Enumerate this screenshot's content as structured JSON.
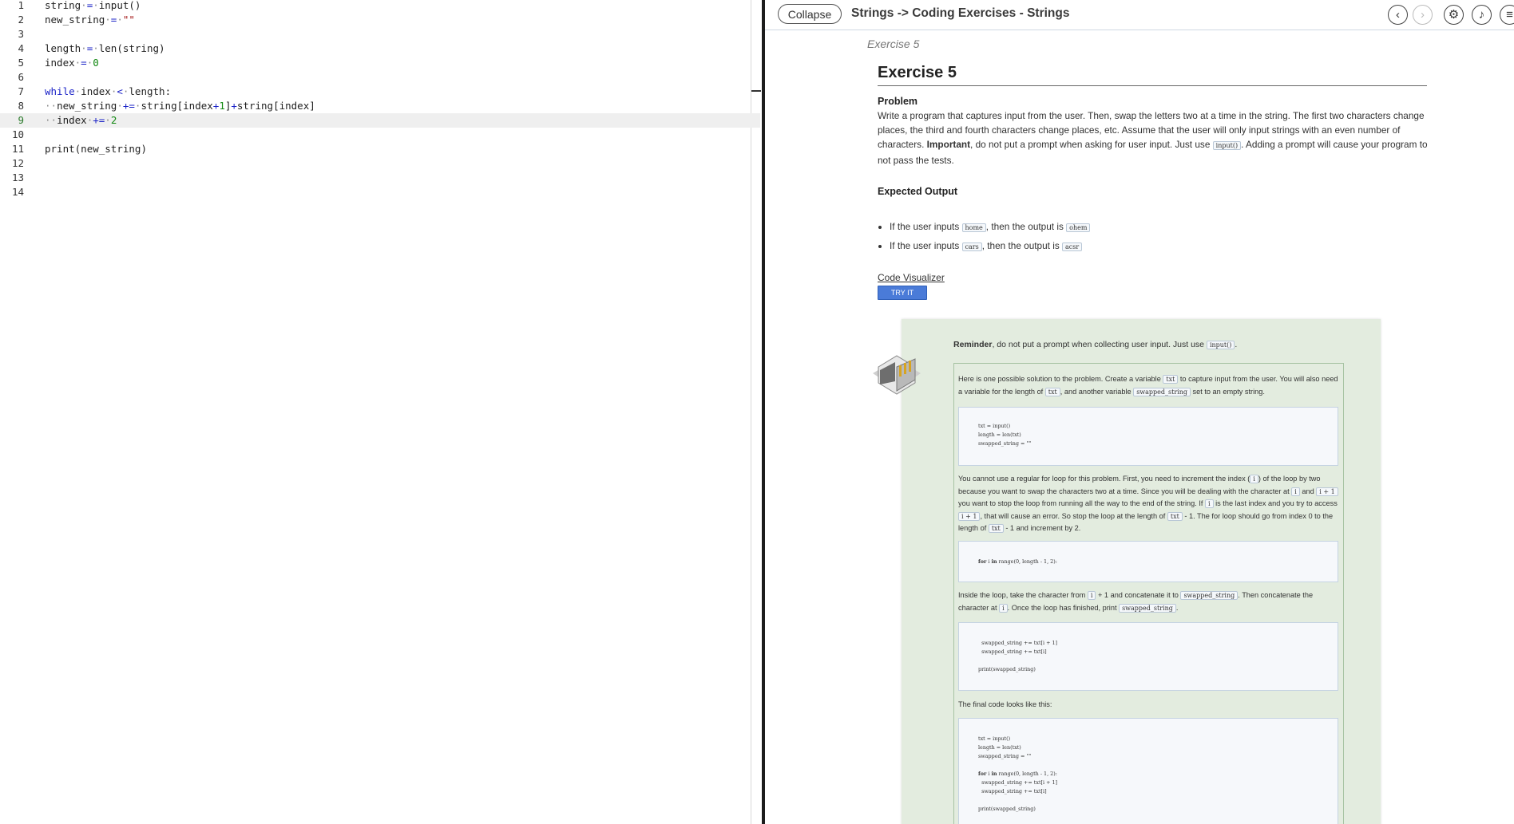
{
  "editor": {
    "lines": [
      {
        "n": "1",
        "t": "string·=·input()"
      },
      {
        "n": "2",
        "t": "new_string·=·\"\""
      },
      {
        "n": "3",
        "t": ""
      },
      {
        "n": "4",
        "t": "length·=·len(string)"
      },
      {
        "n": "5",
        "t": "index·=·0"
      },
      {
        "n": "6",
        "t": ""
      },
      {
        "n": "7",
        "t": "while·index·<·length:"
      },
      {
        "n": "8",
        "t": "··new_string·+=·string[index+1]+string[index]"
      },
      {
        "n": "9",
        "t": "··index·+=·2"
      },
      {
        "n": "10",
        "t": ""
      },
      {
        "n": "11",
        "t": "print(new_string)"
      },
      {
        "n": "12",
        "t": ""
      },
      {
        "n": "13",
        "t": ""
      },
      {
        "n": "14",
        "t": ""
      }
    ],
    "active_line": "9"
  },
  "guide": {
    "collapse_label": "Collapse",
    "breadcrumb": "Strings -> Coding Exercises - Strings",
    "icons": [
      "chevron-left-icon",
      "chevron-right-icon",
      "gear-icon",
      "read-aloud-icon",
      "menu-icon"
    ],
    "subtitle": "Exercise 5",
    "title": "Exercise 5",
    "problem_heading": "Problem",
    "problem_text_1": "Write a program that captures input from the user. Then, swap the letters two at a time in the string. The first two characters change places, the third and fourth characters change places, etc. Assume that the user will only input strings with an even number of characters. ",
    "problem_important": "Important",
    "problem_text_2": ", do not put a prompt when asking for user input. Just use ",
    "problem_code": "input()",
    "problem_text_3": ". Adding a prompt will cause your program to not pass the tests.",
    "expected_heading": "Expected Output",
    "examples": [
      {
        "pre": "If the user inputs ",
        "input": "home",
        "mid": ", then the output is ",
        "output": "ohem"
      },
      {
        "pre": "If the user inputs ",
        "input": "cars",
        "mid": ", then the output is ",
        "output": "acsr"
      }
    ],
    "visualizer_label": "Code Visualizer",
    "try_label": "TRY IT",
    "reminder_bold": "Reminder",
    "reminder_text": ", do not put a prompt when collecting user input. Just use ",
    "reminder_code": "input()",
    "reminder_end": ".",
    "sol_p1_a": "Here is one possible solution to the problem. Create a variable ",
    "sol_p1_c1": "txt",
    "sol_p1_b": " to capture input from the user. You will also need a variable for the length of ",
    "sol_p1_c2": "txt",
    "sol_p1_c": ", and another variable ",
    "sol_p1_c3": "swapped_string",
    "sol_p1_d": " set to an empty string.",
    "code1": [
      "txt = input()",
      "length = len(txt)",
      "swapped_string = \"\""
    ],
    "sol_p2_a": "You cannot use a regular for loop for this problem. First, you need to increment the index (",
    "sol_p2_c1": "i",
    "sol_p2_b": ") of the loop by two because you want to swap the characters two at a time. Since you will be dealing with the character at ",
    "sol_p2_c2": "i",
    "sol_p2_c": " and ",
    "sol_p2_c3": "i + 1",
    "sol_p2_d": " you want to stop the loop from running all the way to the end of the string. If ",
    "sol_p2_c4": "i",
    "sol_p2_e": " is the last index and you try to access ",
    "sol_p2_c5": "i + 1",
    "sol_p2_f": ", that will cause an error. So stop the loop at the length of ",
    "sol_p2_c6": "txt",
    "sol_p2_g": " - 1. The for loop should go from index 0 to the length of ",
    "sol_p2_c7": "txt",
    "sol_p2_h": " - 1 and increment by 2.",
    "code2": [
      "for i in range(0, length - 1, 2):"
    ],
    "sol_p3_a": "Inside the loop, take the character from ",
    "sol_p3_c1": "i",
    "sol_p3_b": " + 1 and concatenate it to ",
    "sol_p3_c2": "swapped_string",
    "sol_p3_c": ". Then concatenate the character at ",
    "sol_p3_c3": "i",
    "sol_p3_d": ". Once the loop has finished, print ",
    "sol_p3_c4": "swapped_string",
    "sol_p3_e": ".",
    "code3": [
      "  swapped_string += txt[i + 1]",
      "  swapped_string += txt[i]",
      "",
      "print(swapped_string)"
    ],
    "sol_p4": "The final code looks like this:",
    "code4": [
      "txt = input()",
      "length = len(txt)",
      "swapped_string = \"\"",
      "",
      "for i in range(0, length - 1, 2):",
      "  swapped_string += txt[i + 1]",
      "  swapped_string += txt[i]",
      "",
      "print(swapped_string)"
    ]
  }
}
